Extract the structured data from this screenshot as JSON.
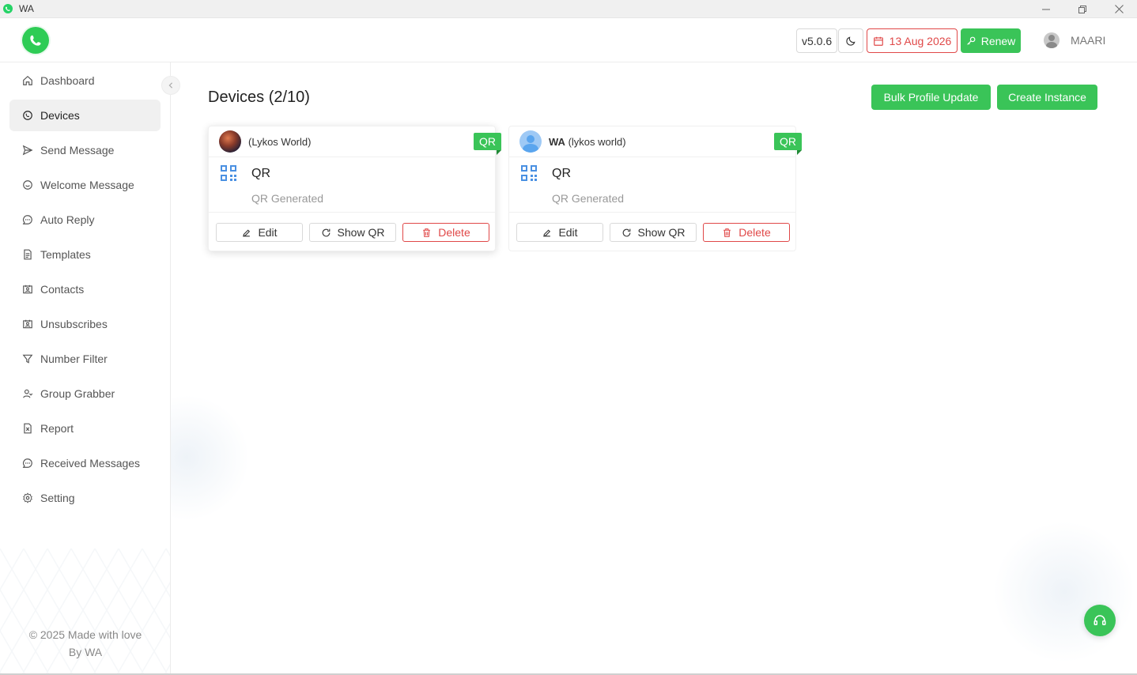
{
  "window": {
    "title": "WA"
  },
  "header": {
    "version": "v5.0.6",
    "expiry_date": "13 Aug 2026",
    "renew_label": "Renew",
    "username": "MAARI"
  },
  "sidebar": {
    "items": [
      {
        "label": "Dashboard",
        "icon": "home-icon",
        "active": false
      },
      {
        "label": "Devices",
        "icon": "whatsapp-icon",
        "active": true
      },
      {
        "label": "Send Message",
        "icon": "send-icon",
        "active": false
      },
      {
        "label": "Welcome Message",
        "icon": "smile-icon",
        "active": false
      },
      {
        "label": "Auto Reply",
        "icon": "chat-icon",
        "active": false
      },
      {
        "label": "Templates",
        "icon": "file-icon",
        "active": false
      },
      {
        "label": "Contacts",
        "icon": "contacts-icon",
        "active": false
      },
      {
        "label": "Unsubscribes",
        "icon": "contacts-icon",
        "active": false
      },
      {
        "label": "Number Filter",
        "icon": "filter-icon",
        "active": false
      },
      {
        "label": "Group Grabber",
        "icon": "user-group-icon",
        "active": false
      },
      {
        "label": "Report",
        "icon": "excel-icon",
        "active": false
      },
      {
        "label": "Received Messages",
        "icon": "chat-icon",
        "active": false
      },
      {
        "label": "Setting",
        "icon": "gear-icon",
        "active": false
      }
    ],
    "footer_line1": "© 2025 Made with love",
    "footer_line2": "By WA"
  },
  "main": {
    "title": "Devices (2/10)",
    "bulk_button": "Bulk Profile Update",
    "create_button": "Create Instance",
    "devices": [
      {
        "name": "",
        "account": "(Lykos World)",
        "badge": "QR",
        "status_title": "QR",
        "status_sub": "QR Generated",
        "edit_label": "Edit",
        "show_qr_label": "Show QR",
        "delete_label": "Delete"
      },
      {
        "name": "WA",
        "account": "(lykos world)",
        "badge": "QR",
        "status_title": "QR",
        "status_sub": "QR Generated",
        "edit_label": "Edit",
        "show_qr_label": "Show QR",
        "delete_label": "Delete"
      }
    ]
  },
  "colors": {
    "accent": "#3ac458",
    "danger": "#e04848"
  }
}
